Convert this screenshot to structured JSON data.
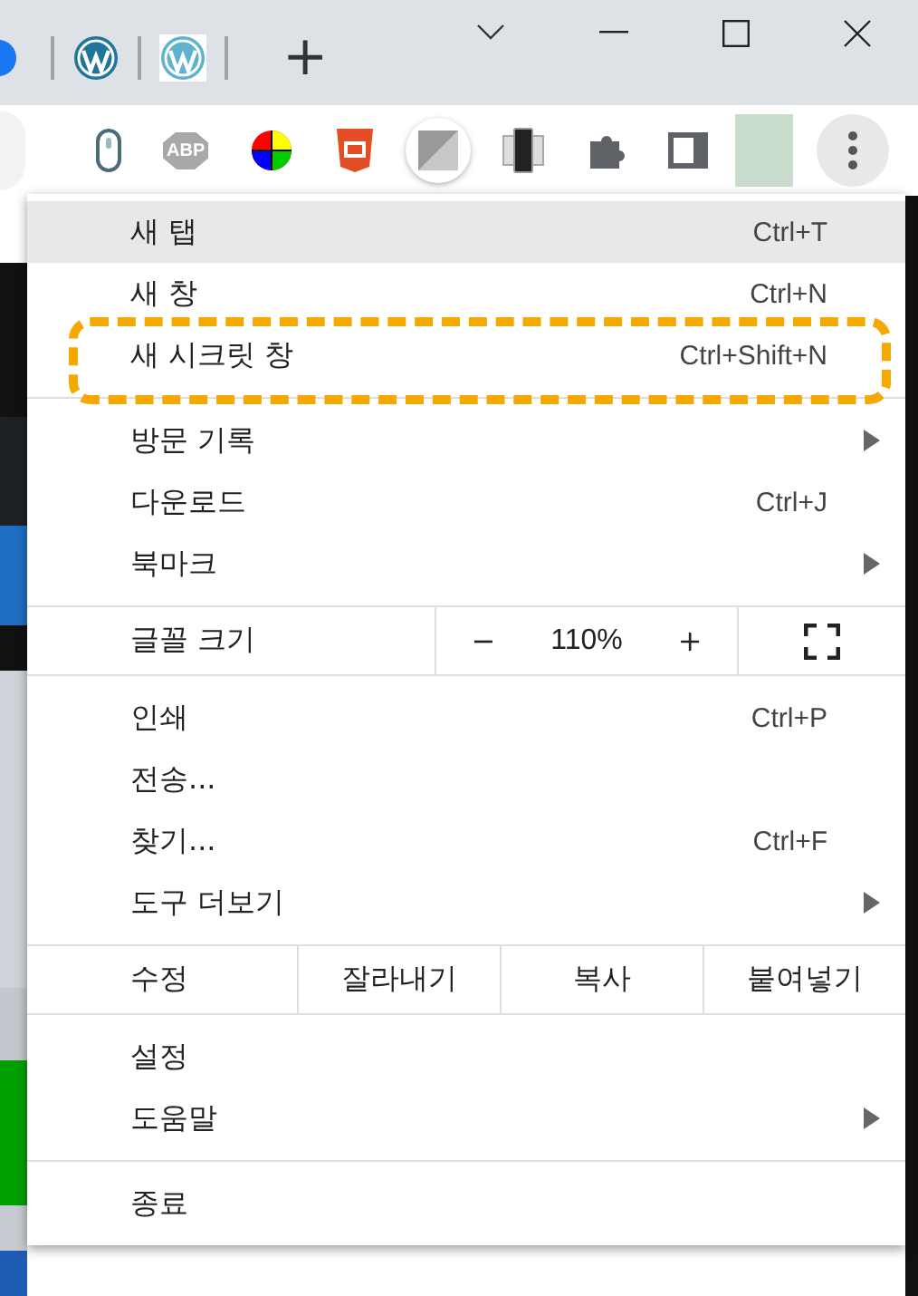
{
  "browser": {
    "new_tab_symbol": "+",
    "extension_badge": "ABP"
  },
  "menu": {
    "sections": [
      {
        "items": [
          {
            "kind": "item",
            "label": "새 탭",
            "shortcut": "Ctrl+T",
            "highlighted": true
          },
          {
            "kind": "item",
            "label": "새 창",
            "shortcut": "Ctrl+N",
            "highlighted": false
          },
          {
            "kind": "item",
            "label": "새 시크릿 창",
            "shortcut": "Ctrl+Shift+N",
            "highlighted": false,
            "outlined": true
          }
        ]
      },
      {
        "items": [
          {
            "kind": "item",
            "label": "방문 기록",
            "submenu": true,
            "highlighted": false
          },
          {
            "kind": "item",
            "label": "다운로드",
            "shortcut": "Ctrl+J",
            "highlighted": false
          },
          {
            "kind": "item",
            "label": "북마크",
            "submenu": true,
            "highlighted": false
          }
        ]
      },
      {
        "items": [
          {
            "kind": "zoom",
            "label": "글꼴 크기",
            "minus": "−",
            "value": "110%",
            "plus": "+"
          }
        ]
      },
      {
        "items": [
          {
            "kind": "item",
            "label": "인쇄",
            "shortcut": "Ctrl+P",
            "highlighted": false
          },
          {
            "kind": "item",
            "label": "전송...",
            "highlighted": false
          },
          {
            "kind": "item",
            "label": "찾기...",
            "shortcut": "Ctrl+F",
            "highlighted": false
          },
          {
            "kind": "item",
            "label": "도구 더보기",
            "submenu": true,
            "highlighted": false
          }
        ]
      },
      {
        "items": [
          {
            "kind": "edit",
            "label": "수정",
            "buttons": [
              "잘라내기",
              "복사",
              "붙여넣기"
            ]
          }
        ]
      },
      {
        "items": [
          {
            "kind": "item",
            "label": "설정",
            "highlighted": false
          },
          {
            "kind": "item",
            "label": "도움말",
            "submenu": true,
            "highlighted": false
          }
        ]
      },
      {
        "items": [
          {
            "kind": "item",
            "label": "종료",
            "highlighted": false
          }
        ]
      }
    ]
  }
}
